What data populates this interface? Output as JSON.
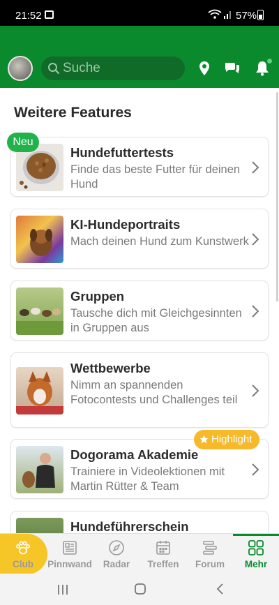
{
  "status_bar": {
    "time": "21:52",
    "battery": "57%"
  },
  "header": {
    "search_placeholder": "Suche"
  },
  "section_title": "Weitere Features",
  "badges": {
    "new": "Neu",
    "highlight": "Highlight"
  },
  "features": [
    {
      "title": "Hundefuttertests",
      "desc": "Finde das beste Futter für deinen Hund"
    },
    {
      "title": "KI-Hundeportraits",
      "desc": "Mach deinen Hund zum Kunstwerk"
    },
    {
      "title": "Gruppen",
      "desc": "Tausche dich mit Gleichgesinnten in Gruppen aus"
    },
    {
      "title": "Wettbewerbe",
      "desc": "Nimm an spannenden Fotocontests und Challenges teil"
    },
    {
      "title": "Dogorama Akademie",
      "desc": "Trainiere in Videolektionen mit Martin Rütter & Team"
    },
    {
      "title": "Hundeführerschein",
      "desc": ""
    }
  ],
  "bottom_nav": [
    {
      "label": "Club",
      "icon": "paw-icon"
    },
    {
      "label": "Pinnwand",
      "icon": "newspaper-icon"
    },
    {
      "label": "Radar",
      "icon": "compass-icon"
    },
    {
      "label": "Treffen",
      "icon": "calendar-icon"
    },
    {
      "label": "Forum",
      "icon": "forum-icon"
    },
    {
      "label": "Mehr",
      "icon": "grid-icon"
    }
  ],
  "colors": {
    "brand_green": "#0a8a2d",
    "club_yellow": "#f6c528",
    "badge_new": "#22b24c",
    "badge_highlight": "#f6b92a"
  }
}
